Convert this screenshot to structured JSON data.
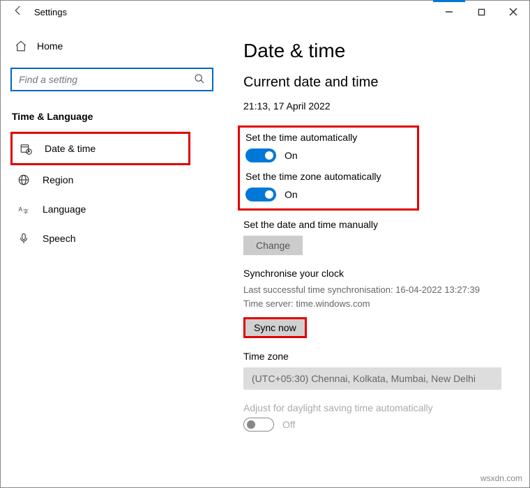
{
  "window": {
    "title": "Settings"
  },
  "sidebar": {
    "home_label": "Home",
    "search_placeholder": "Find a setting",
    "group_title": "Time & Language",
    "items": [
      {
        "label": "Date & time"
      },
      {
        "label": "Region"
      },
      {
        "label": "Language"
      },
      {
        "label": "Speech"
      }
    ]
  },
  "content": {
    "heading": "Date & time",
    "subheading": "Current date and time",
    "current_datetime": "21:13, 17 April 2022",
    "auto_time_label": "Set the time automatically",
    "auto_time_state": "On",
    "auto_tz_label": "Set the time zone automatically",
    "auto_tz_state": "On",
    "manual_label": "Set the date and time manually",
    "change_button": "Change",
    "sync_title": "Synchronise your clock",
    "sync_last": "Last successful time synchronisation: 16-04-2022 13:27:39",
    "sync_server": "Time server: time.windows.com",
    "sync_button": "Sync now",
    "tz_title": "Time zone",
    "tz_value": "(UTC+05:30) Chennai, Kolkata, Mumbai, New Delhi",
    "dst_label": "Adjust for daylight saving time automatically",
    "dst_state": "Off"
  },
  "watermark": "wsxdn.com"
}
